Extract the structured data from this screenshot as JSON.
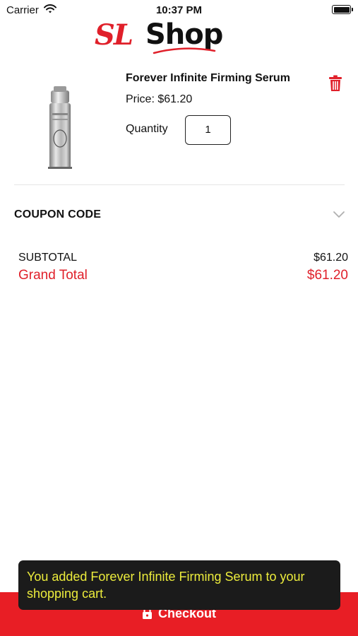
{
  "status_bar": {
    "carrier": "Carrier",
    "time": "10:37 PM"
  },
  "logo": {
    "script_part": "SL",
    "word_part": "Shop",
    "accent_color": "#e0202a"
  },
  "cart_item": {
    "name": "Forever Infinite Firming Serum",
    "price": "Price: $61.20",
    "quantity_label": "Quantity",
    "quantity": "1"
  },
  "coupon": {
    "label": "COUPON CODE"
  },
  "totals": {
    "subtotal_label": "SUBTOTAL",
    "subtotal_value": "$61.20",
    "grand_label": "Grand Total",
    "grand_value": "$61.20"
  },
  "checkout": {
    "label": "Checkout",
    "color": "#e81e25"
  },
  "toast": {
    "message": "You added Forever Infinite Firming Serum to your shopping cart."
  },
  "icons": [
    "wifi-icon",
    "battery-icon",
    "trash-icon",
    "chevron-down-icon",
    "lock-icon"
  ]
}
